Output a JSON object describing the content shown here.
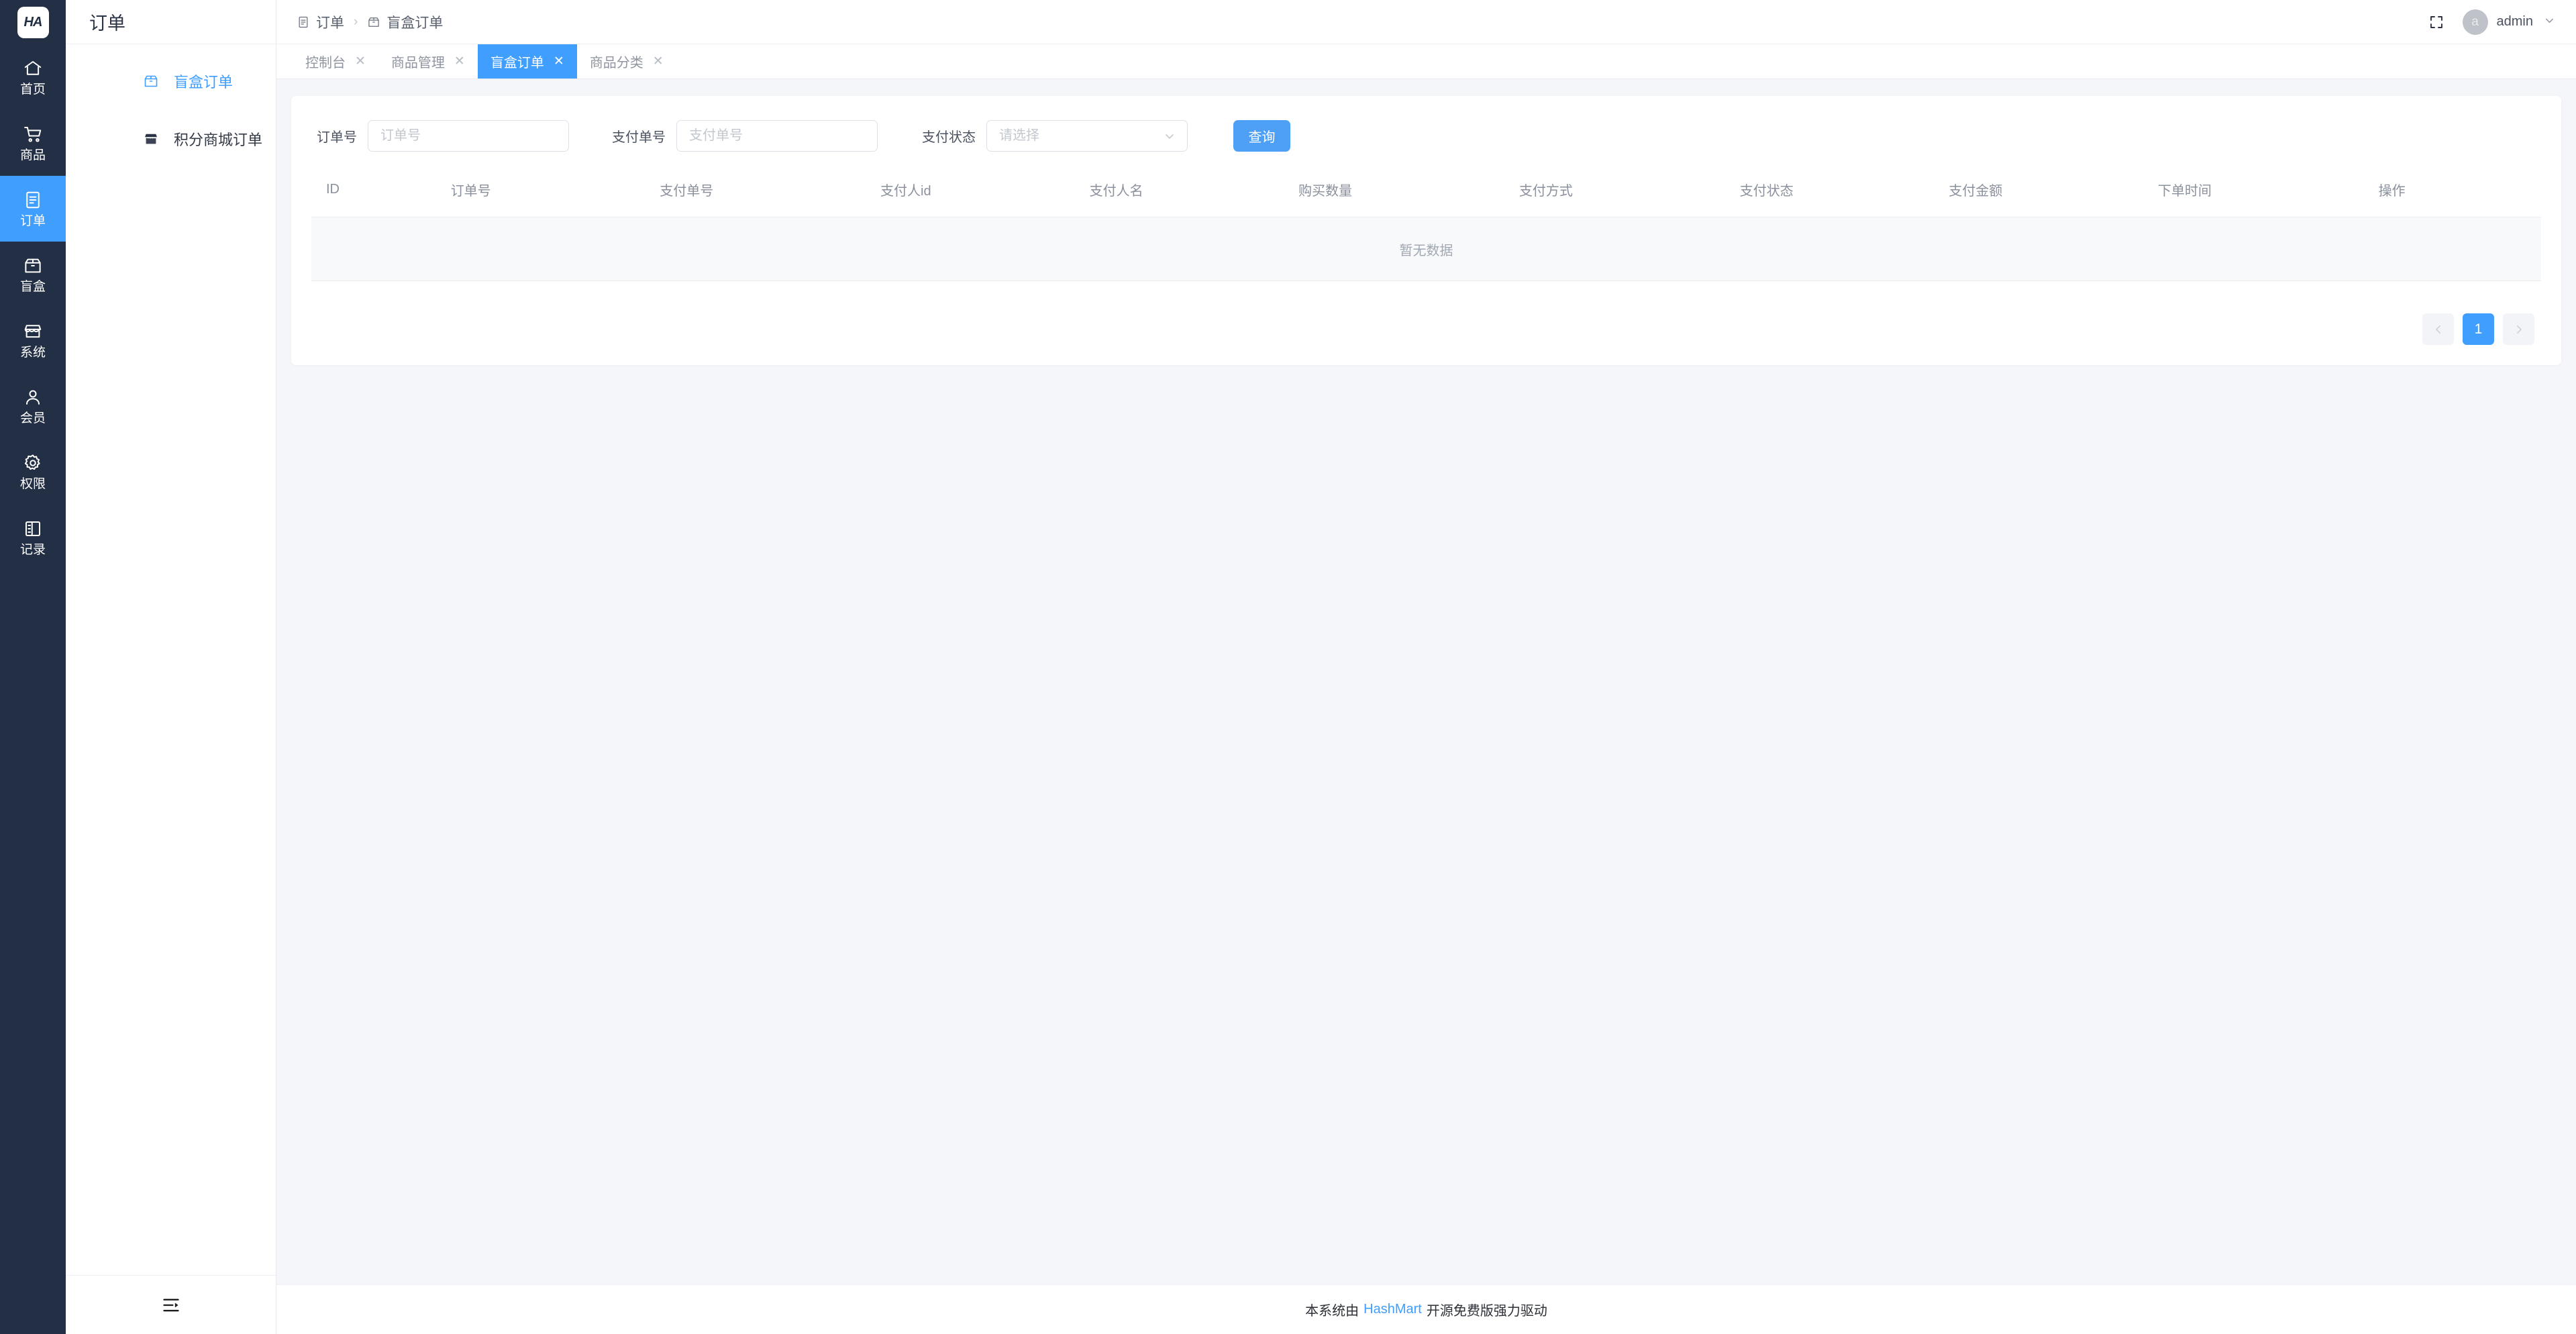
{
  "brand": {
    "logo_text": "HA",
    "accent_color": "#409eff",
    "rail_color": "#232f45"
  },
  "rail": {
    "items": [
      {
        "label": "首页",
        "icon": "home-icon",
        "active": false
      },
      {
        "label": "商品",
        "icon": "cart-icon",
        "active": false
      },
      {
        "label": "订单",
        "icon": "document-icon",
        "active": true
      },
      {
        "label": "盲盒",
        "icon": "box-icon",
        "active": false
      },
      {
        "label": "系统",
        "icon": "shop-icon",
        "active": false
      },
      {
        "label": "会员",
        "icon": "user-icon",
        "active": false
      },
      {
        "label": "权限",
        "icon": "gear-icon",
        "active": false
      },
      {
        "label": "记录",
        "icon": "notebook-icon",
        "active": false
      }
    ]
  },
  "submenu": {
    "title": "订单",
    "items": [
      {
        "label": "盲盒订单",
        "icon": "box-icon",
        "active": true
      },
      {
        "label": "积分商城订单",
        "icon": "shop-icon",
        "active": false
      }
    ],
    "collapse_icon": "menu-fold-icon"
  },
  "topbar": {
    "breadcrumb": [
      {
        "label": "订单",
        "icon": "document-icon"
      },
      {
        "label": "盲盒订单",
        "icon": "box-icon"
      }
    ],
    "separator": "›",
    "fullscreen_icon": "fullscreen-icon",
    "user": {
      "avatar_letter": "a",
      "name": "admin",
      "caret": "chevron-down-icon"
    }
  },
  "tabs": [
    {
      "label": "控制台",
      "active": false,
      "closable": true
    },
    {
      "label": "商品管理",
      "active": false,
      "closable": true
    },
    {
      "label": "盲盒订单",
      "active": true,
      "closable": true
    },
    {
      "label": "商品分类",
      "active": false,
      "closable": true
    }
  ],
  "filters": {
    "order_no": {
      "label": "订单号",
      "value": "",
      "placeholder": "订单号"
    },
    "pay_no": {
      "label": "支付单号",
      "value": "",
      "placeholder": "支付单号"
    },
    "pay_status": {
      "label": "支付状态",
      "value": "",
      "placeholder": "请选择",
      "options": []
    },
    "search_button": "查询"
  },
  "table": {
    "columns": [
      "ID",
      "订单号",
      "支付单号",
      "支付人id",
      "支付人名",
      "购买数量",
      "支付方式",
      "支付状态",
      "支付金额",
      "下单时间",
      "操作"
    ],
    "rows": [],
    "empty_text": "暂无数据"
  },
  "pagination": {
    "prev_icon": "chevron-left-icon",
    "next_icon": "chevron-right-icon",
    "pages": [
      "1"
    ],
    "current": "1"
  },
  "footer": {
    "prefix": "本系统由",
    "link": "HashMart",
    "suffix": "开源免费版强力驱动"
  }
}
